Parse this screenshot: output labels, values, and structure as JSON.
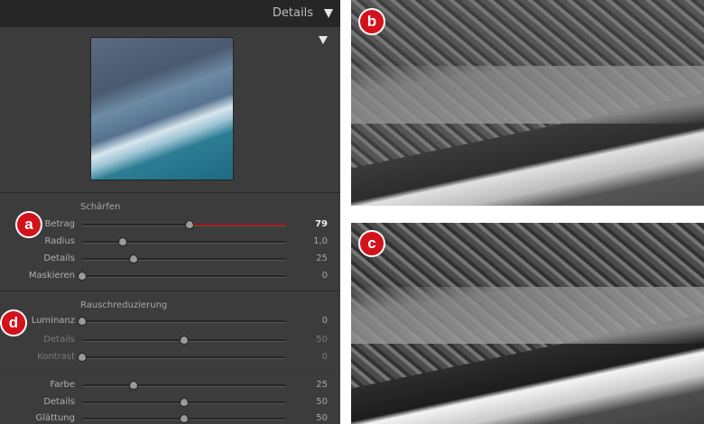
{
  "header": {
    "title": "Details"
  },
  "sharpening": {
    "title": "Schärfen",
    "rows": [
      {
        "label": "Betrag",
        "value": "79",
        "fraction": 0.527
      },
      {
        "label": "Radius",
        "value": "1,0",
        "fraction": 0.2
      },
      {
        "label": "Details",
        "value": "25",
        "fraction": 0.25
      },
      {
        "label": "Maskieren",
        "value": "0",
        "fraction": 0
      }
    ]
  },
  "noise": {
    "title": "Rauschreduzierung",
    "rows": [
      {
        "label": "Luminanz",
        "value": "0",
        "fraction": 0
      },
      {
        "label": "Details",
        "value": "50",
        "fraction": 0.5
      },
      {
        "label": "Kontrast",
        "value": "0",
        "fraction": 0
      }
    ]
  },
  "color": {
    "rows": [
      {
        "label": "Farbe",
        "value": "25",
        "fraction": 0.25
      },
      {
        "label": "Details",
        "value": "50",
        "fraction": 0.5
      },
      {
        "label": "Glättung",
        "value": "50",
        "fraction": 0.5
      }
    ]
  },
  "badges": {
    "a": "a",
    "b": "b",
    "c": "c",
    "d": "d"
  },
  "colors": {
    "badge": "#d3121b",
    "panel": "#3c3c3c",
    "header": "#262626"
  }
}
